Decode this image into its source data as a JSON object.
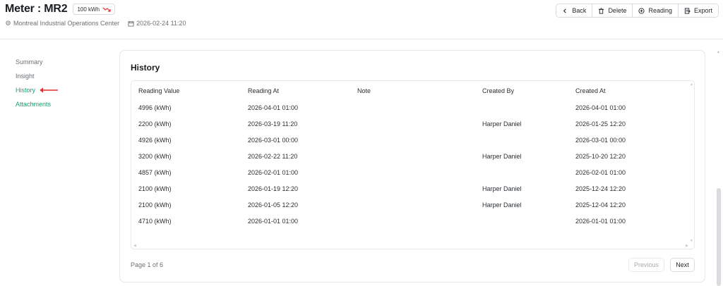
{
  "header": {
    "title": "Meter : MR2",
    "badge_value": "100 kWh",
    "location": "Montreal Industrial Operations Center",
    "datetime": "2026-02-24 11:20"
  },
  "toolbar": {
    "back_label": "Back",
    "delete_label": "Delete",
    "reading_label": "Reading",
    "export_label": "Export"
  },
  "sidebar": {
    "items": [
      {
        "label": "Summary"
      },
      {
        "label": "Insight"
      },
      {
        "label": "History"
      },
      {
        "label": "Attachments"
      }
    ]
  },
  "history": {
    "title": "History",
    "columns": [
      "Reading Value",
      "Reading At",
      "Note",
      "Created By",
      "Created At"
    ],
    "rows": [
      [
        "4996 (kWh)",
        "2026-04-01 01:00",
        "",
        "",
        "2026-04-01 01:00"
      ],
      [
        "2200 (kWh)",
        "2026-03-19 11:20",
        "",
        "Harper Daniel",
        "2026-01-25 12:20"
      ],
      [
        "4926 (kWh)",
        "2026-03-01 00:00",
        "",
        "",
        "2026-03-01 00:00"
      ],
      [
        "3200 (kWh)",
        "2026-02-22 11:20",
        "",
        "Harper Daniel",
        "2025-10-20 12:20"
      ],
      [
        "4857 (kWh)",
        "2026-02-01 01:00",
        "",
        "",
        "2026-02-01 01:00"
      ],
      [
        "2100 (kWh)",
        "2026-01-19 12:20",
        "",
        "Harper Daniel",
        "2025-12-24 12:20"
      ],
      [
        "2100 (kWh)",
        "2026-01-05 12:20",
        "",
        "Harper Daniel",
        "2025-12-04 12:20"
      ],
      [
        "4710 (kWh)",
        "2026-01-01 01:00",
        "",
        "",
        "2026-01-01 01:00"
      ]
    ]
  },
  "pagination": {
    "page_text": "Page 1 of 6",
    "previous_label": "Previous",
    "next_label": "Next"
  },
  "colors": {
    "accent": "#1aa06b",
    "annotation_arrow": "#e0302b",
    "trend": "#e0302b"
  },
  "icons": {
    "trend": "trend-down-icon",
    "location": "location-pin-icon",
    "calendar": "calendar-icon",
    "back": "chevron-left-icon",
    "delete": "trash-icon",
    "reading": "plus-circle-icon",
    "export": "export-icon"
  }
}
